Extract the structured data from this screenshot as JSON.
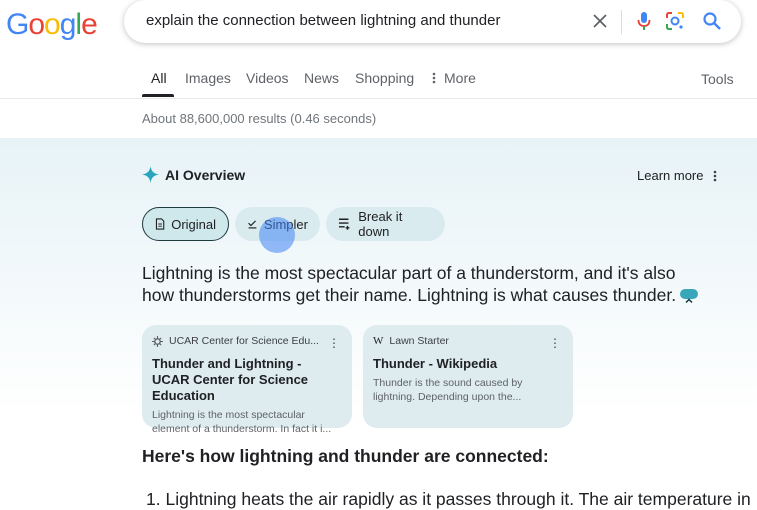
{
  "logo": {
    "text": "Google"
  },
  "search": {
    "query": "explain the connection between lightning and thunder"
  },
  "tabs": [
    {
      "label": "All"
    },
    {
      "label": "Images"
    },
    {
      "label": "Videos"
    },
    {
      "label": "News"
    },
    {
      "label": "Shopping"
    },
    {
      "label": "More"
    }
  ],
  "tools_label": "Tools",
  "result_stats": "About 88,600,000 results (0.46 seconds)",
  "ai_overview": {
    "title": "AI Overview",
    "learn_more": "Learn more",
    "chips": [
      {
        "label": "Original"
      },
      {
        "label": "Simpler"
      },
      {
        "label": "Break it down"
      }
    ],
    "summary": "Lightning is the most spectacular part of a thunderstorm, and it's also how thunderstorms get their name. Lightning is what causes thunder.",
    "cards": [
      {
        "source": "UCAR Center for Science Edu...",
        "title": "Thunder and Lightning - UCAR Center for Science Education",
        "snippet": "Lightning is the most spectacular element of a thunderstorm. In fact it i..."
      },
      {
        "source": "Lawn Starter",
        "title": "Thunder - Wikipedia",
        "snippet": "Thunder is the sound caused by lightning. Depending upon the..."
      }
    ],
    "connected_heading": "Here's how lightning and thunder are connected:",
    "list": [
      {
        "number": "1.",
        "text": "Lightning heats the air rapidly as it passes through it. The air temperature in"
      }
    ]
  },
  "colors": {
    "accent_teal": "#3aa6b9",
    "chip_bg": "#d9ebef",
    "card_bg": "#deecef"
  }
}
